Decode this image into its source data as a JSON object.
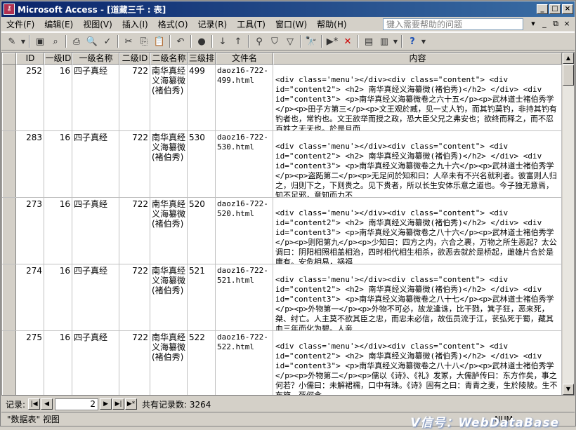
{
  "window": {
    "title": "Microsoft Access - [道藏三千 : 表]",
    "app_icon": "access-key-icon"
  },
  "menu": [
    "文件(F)",
    "编辑(E)",
    "视图(V)",
    "插入(I)",
    "格式(O)",
    "记录(R)",
    "工具(T)",
    "窗口(W)",
    "帮助(H)"
  ],
  "help_placeholder": "键入需要帮助的问题",
  "columns": [
    "ID",
    "一级ID",
    "一级名称",
    "二级ID",
    "二级名称",
    "三级排",
    "文件名",
    "内容"
  ],
  "rows": [
    {
      "id": "252",
      "l1id": "16",
      "l1name": "四子真经",
      "l2id": "722",
      "l2name": "南华真经义海纂微(褚伯秀)",
      "l3": "499",
      "file": "daoz16-722-499.html",
      "content": "<div class='menu'></div><div class=\"content\"> <div id=\"content2\"> <h2> 南华真经义海纂微(褚伯秀)</h2> </div> <div id=\"content3\"> <p>南华真经义海纂微卷之六十五</p><p>武林道士褚伯秀学</p><p>田子方第三</p><p>文王观於臧，见一丈人钓，而其钓莫钓，非持其钓有钓者也，常钓也。文王欲举而授之政，恐大臣父兄之弗安也；欲终而释之，而不忍百姓之无天也。於是旦而"
    },
    {
      "id": "283",
      "l1id": "16",
      "l1name": "四子真经",
      "l2id": "722",
      "l2name": "南华真经义海纂微(褚伯秀)",
      "l3": "530",
      "file": "daoz16-722-530.html",
      "content": "<div class='menu'></div><div class=\"content\"> <div id=\"content2\"> <h2> 南华真经义海纂微(褚伯秀)</h2> </div> <div id=\"content3\"> <p>南华真经义海纂微卷之九十六</p><p>武林道士褚伯秀学</p><p>盗跖第二</p><p>无足问於知和曰：人卒未有不兴名就利者。彼富则人归之，归则下之，下则贵之。见下贵者，所以长生安体乐意之道也。今子独无意焉，知不足邪，意知而力不"
    },
    {
      "id": "273",
      "l1id": "16",
      "l1name": "四子真经",
      "l2id": "722",
      "l2name": "南华真经义海纂微(褚伯秀)",
      "l3": "520",
      "file": "daoz16-722-520.html",
      "content": "<div class='menu'></div><div class=\"content\"> <div id=\"content2\"> <h2> 南华真经义海纂微(褚伯秀)</h2> </div> <div id=\"content3\"> <p>南华真经义海纂微卷之八十六</p><p>武林道士褚伯秀学</p><p>则阳第九</p><p>少知曰：四方之内，六合之裹，万物之所生恶起？太公调曰：阴阳相照相盖相治，四时相代相生相杀，欲恶去就於是桥起，雌雄片合於是庸有。安危相易，祸福"
    },
    {
      "id": "274",
      "l1id": "16",
      "l1name": "四子真经",
      "l2id": "722",
      "l2name": "南华真经义海纂微(褚伯秀)",
      "l3": "521",
      "file": "daoz16-722-521.html",
      "content": "<div class='menu'></div><div class=\"content\"> <div id=\"content2\"> <h2> 南华真经义海纂微(褚伯秀)</h2> </div> <div id=\"content3\"> <p>南华真经义海纂微卷之八十七</p><p>武林道士褚伯秀学</p><p>外物第一</p><p>外物不可必，故龙逢诛，比干戮，箕子狂，恶来死，桀、纣亡。人主莫不欲其臣之忠，而忠未必信，故伍员流于江，苌弘死于蜀，藏其血三年而化为碧。人亲"
    },
    {
      "id": "275",
      "l1id": "16",
      "l1name": "四子真经",
      "l2id": "722",
      "l2name": "南华真经义海纂微(褚伯秀)",
      "l3": "522",
      "file": "daoz16-722-522.html",
      "content": "<div class='menu'></div><div class=\"content\"> <div id=\"content2\"> <h2> 南华真经义海纂微(褚伯秀)</h2> </div> <div id=\"content3\"> <p>南华真经义海纂微卷之八十八</p><p>武林道士褚伯秀学</p><p>外物第二</p><p>儒以《诗》、《礼》发冢，大儒胪传曰：东方作矣，事之何若？小儒曰：未解裙襦，口中有珠。《诗》固有之曰：青青之麦，生於陵陂。生不布施，死何含"
    }
  ],
  "nav": {
    "label": "记录:",
    "current": "2",
    "total_text": "共有记录数: 3264"
  },
  "status": {
    "view_text": "\"数据表\" 视图",
    "num_indicator": "NUM",
    "watermark": "V信号：WebDataBase"
  }
}
